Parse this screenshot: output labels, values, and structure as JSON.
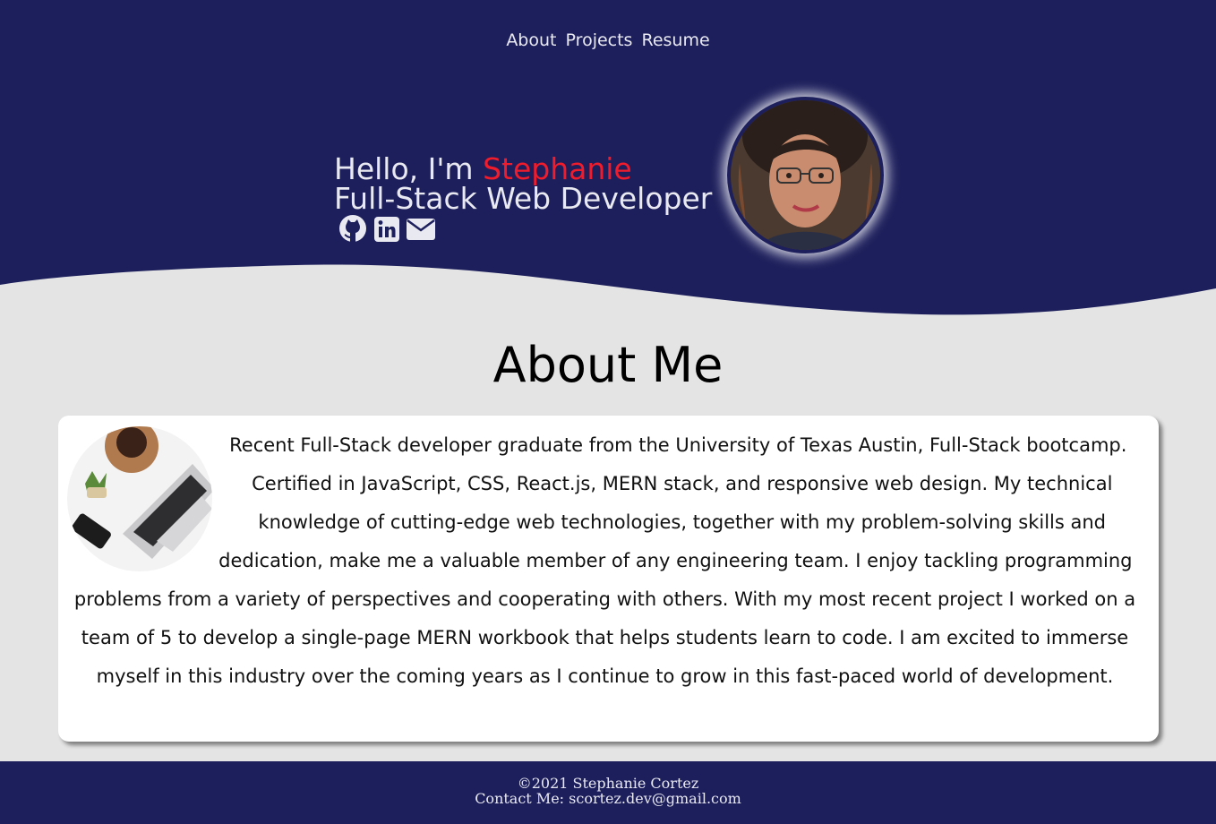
{
  "colors": {
    "navy": "#1d1f5c",
    "accent_red": "#f01c2c",
    "page_bg": "#e4e4e4",
    "card_bg": "#ffffff"
  },
  "nav": {
    "items": [
      "About",
      "Projects",
      "Resume"
    ]
  },
  "hero": {
    "greeting": "Hello, I'm ",
    "name": "Stephanie",
    "role": "Full-Stack Web Developer",
    "socials": [
      "github-icon",
      "linkedin-icon",
      "email-icon"
    ]
  },
  "about": {
    "title": "About Me",
    "text": "Recent Full-Stack developer graduate from the University of Texas Austin, Full-Stack bootcamp. Certified in JavaScript, CSS, React.js, MERN stack, and responsive web design. My technical knowledge of cutting-edge web technologies, together with my problem-solving skills and dedication, make me a valuable member of any engineering team. I enjoy tackling programming problems from a variety of perspectives and cooperating with others. With my most recent project I worked on a team of 5 to develop a single-page MERN workbook that helps students learn to code. I am excited to immerse myself in this industry over the coming years as I continue to grow in this fast-paced world of development."
  },
  "footer": {
    "copyright": "©2021 Stephanie Cortez",
    "contact": "Contact Me: scortez.dev@gmail.com"
  }
}
